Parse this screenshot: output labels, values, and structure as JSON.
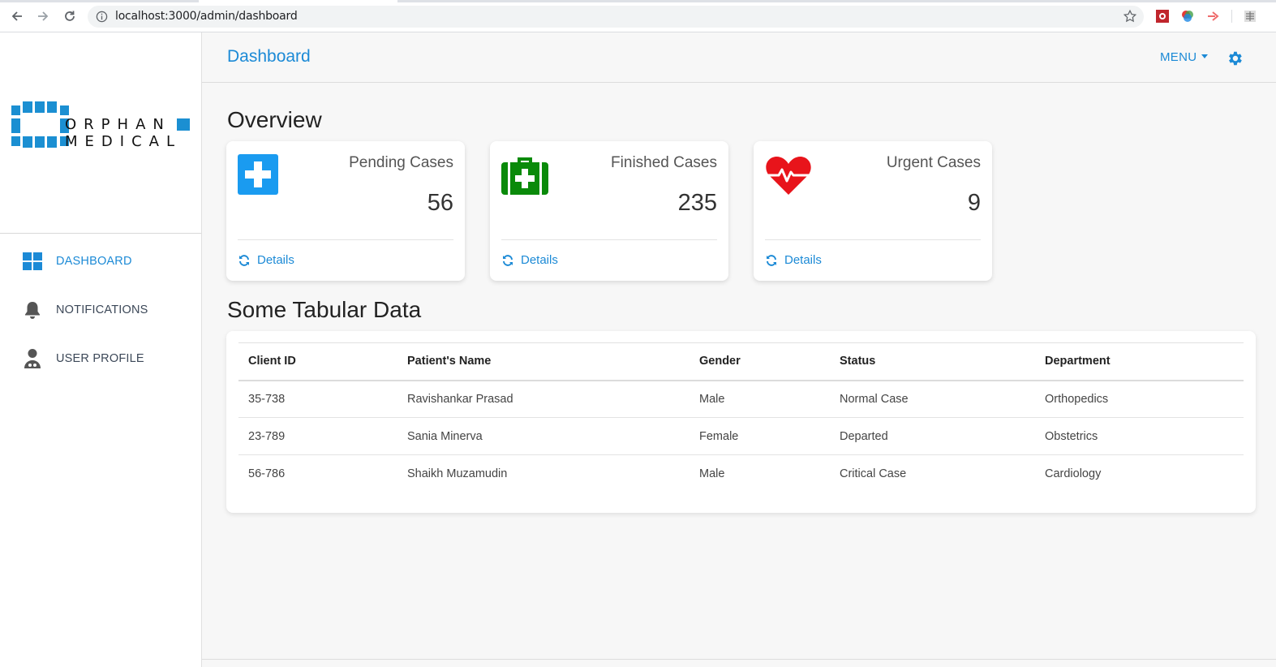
{
  "browser": {
    "url": "localhost:3000/admin/dashboard"
  },
  "sidebar": {
    "brand_top": "ORPHAN",
    "brand_bottom": "MEDICAL",
    "items": [
      {
        "label": "DASHBOARD",
        "icon": "dashboard-grid-icon",
        "active": true
      },
      {
        "label": "NOTIFICATIONS",
        "icon": "bell-icon",
        "active": false
      },
      {
        "label": "USER PROFILE",
        "icon": "doctor-user-icon",
        "active": false
      }
    ]
  },
  "header": {
    "title": "Dashboard",
    "menu_label": "MENU"
  },
  "overview": {
    "title": "Overview",
    "cards": [
      {
        "label": "Pending Cases",
        "value": "56",
        "details": "Details",
        "icon": "medical-plus-icon",
        "color": "#1a9bf0"
      },
      {
        "label": "Finished Cases",
        "value": "235",
        "details": "Details",
        "icon": "first-aid-kit-icon",
        "color": "#0a8a0a"
      },
      {
        "label": "Urgent Cases",
        "value": "9",
        "details": "Details",
        "icon": "heartbeat-icon",
        "color": "#e8141b"
      }
    ]
  },
  "table": {
    "title": "Some Tabular Data",
    "columns": [
      "Client ID",
      "Patient's Name",
      "Gender",
      "Status",
      "Department"
    ],
    "rows": [
      [
        "35-738",
        "Ravishankar Prasad",
        "Male",
        "Normal Case",
        "Orthopedics"
      ],
      [
        "23-789",
        "Sania Minerva",
        "Female",
        "Departed",
        "Obstetrics"
      ],
      [
        "56-786",
        "Shaikh Muzamudin",
        "Male",
        "Critical Case",
        "Cardiology"
      ]
    ]
  },
  "colors": {
    "accent": "#1c8ad6",
    "logo_blue": "#1b8fd2"
  }
}
